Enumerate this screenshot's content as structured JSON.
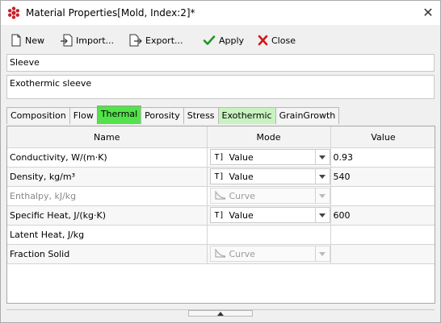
{
  "window": {
    "title": "Material Properties[Mold, Index:2]*",
    "close_glyph": "✕"
  },
  "toolbar": {
    "new_label": "New",
    "import_label": "Import...",
    "export_label": "Export...",
    "apply_label": "Apply",
    "close_label": "Close"
  },
  "material": {
    "name": "Sleeve",
    "description": "Exothermic sleeve"
  },
  "tabs": [
    {
      "label": "Composition",
      "state": "normal"
    },
    {
      "label": "Flow",
      "state": "normal"
    },
    {
      "label": "Thermal",
      "state": "active"
    },
    {
      "label": "Porosity",
      "state": "normal"
    },
    {
      "label": "Stress",
      "state": "normal"
    },
    {
      "label": "Exothermic",
      "state": "highlight"
    },
    {
      "label": "GrainGrowth",
      "state": "normal"
    }
  ],
  "table": {
    "headers": {
      "name": "Name",
      "mode": "Mode",
      "value": "Value"
    },
    "rows": [
      {
        "name": "Conductivity, W/(m·K)",
        "mode": "Value",
        "mode_icon": "value-icon",
        "value": "0.93",
        "enabled": true
      },
      {
        "name": "Density, kg/m³",
        "mode": "Value",
        "mode_icon": "value-icon",
        "value": "540",
        "enabled": true
      },
      {
        "name": "Enthalpy, kJ/kg",
        "mode": "Curve",
        "mode_icon": "curve-icon",
        "value": "",
        "enabled": false
      },
      {
        "name": "Specific Heat, J/(kg·K)",
        "mode": "Value",
        "mode_icon": "value-icon",
        "value": "600",
        "enabled": true
      },
      {
        "name": "Latent Heat, J/kg",
        "mode": "",
        "mode_icon": "",
        "value": "",
        "enabled": true
      },
      {
        "name": "Fraction Solid",
        "mode": "Curve",
        "mode_icon": "curve-icon",
        "value": "",
        "enabled": false
      }
    ]
  },
  "colors": {
    "active_tab": "#53e24b",
    "highlight_tab": "#c8f2c0",
    "apply_check": "#1f9a1f",
    "close_x": "#d01818"
  }
}
